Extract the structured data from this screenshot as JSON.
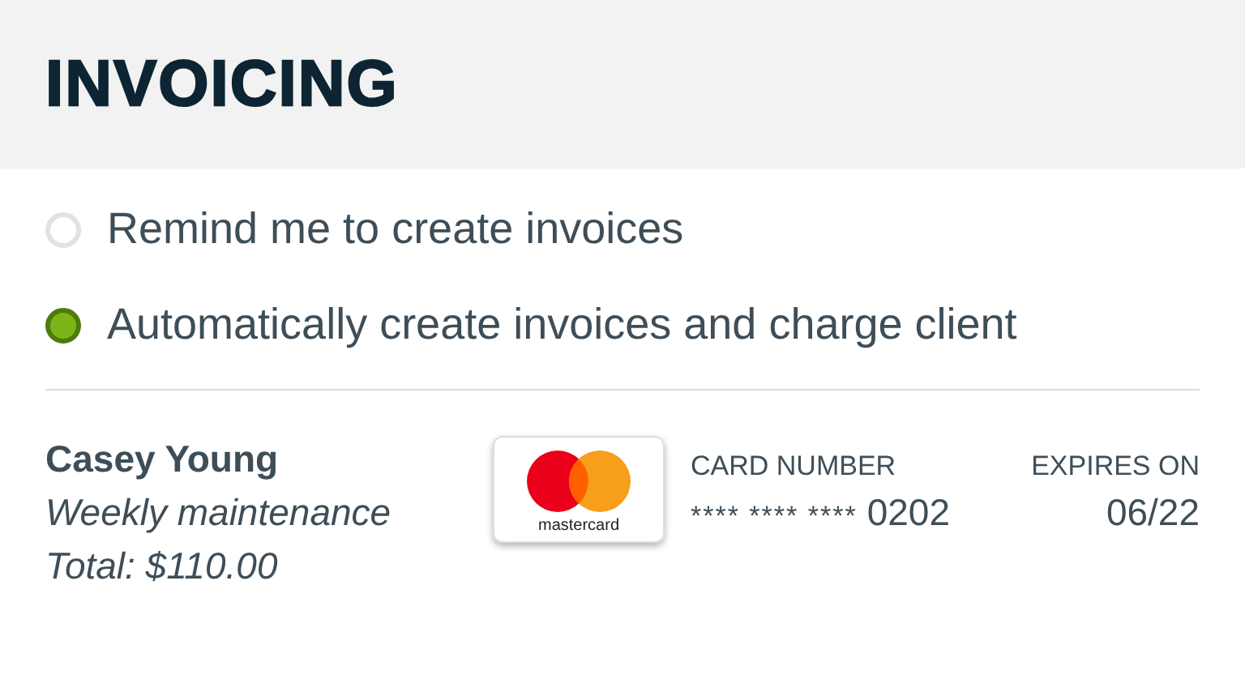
{
  "header": {
    "title": "INVOICING"
  },
  "options": [
    {
      "label": "Remind me to create invoices",
      "selected": false
    },
    {
      "label": "Automatically create invoices and charge client",
      "selected": true
    }
  ],
  "client": {
    "name": "Casey Young",
    "service": "Weekly maintenance",
    "total": "Total: $110.00"
  },
  "card": {
    "brand": "mastercard",
    "number_label": "CARD NUMBER",
    "masked": "**** **** ****",
    "last4": "0202",
    "expires_label": "EXPIRES ON",
    "expires": "06/22"
  }
}
